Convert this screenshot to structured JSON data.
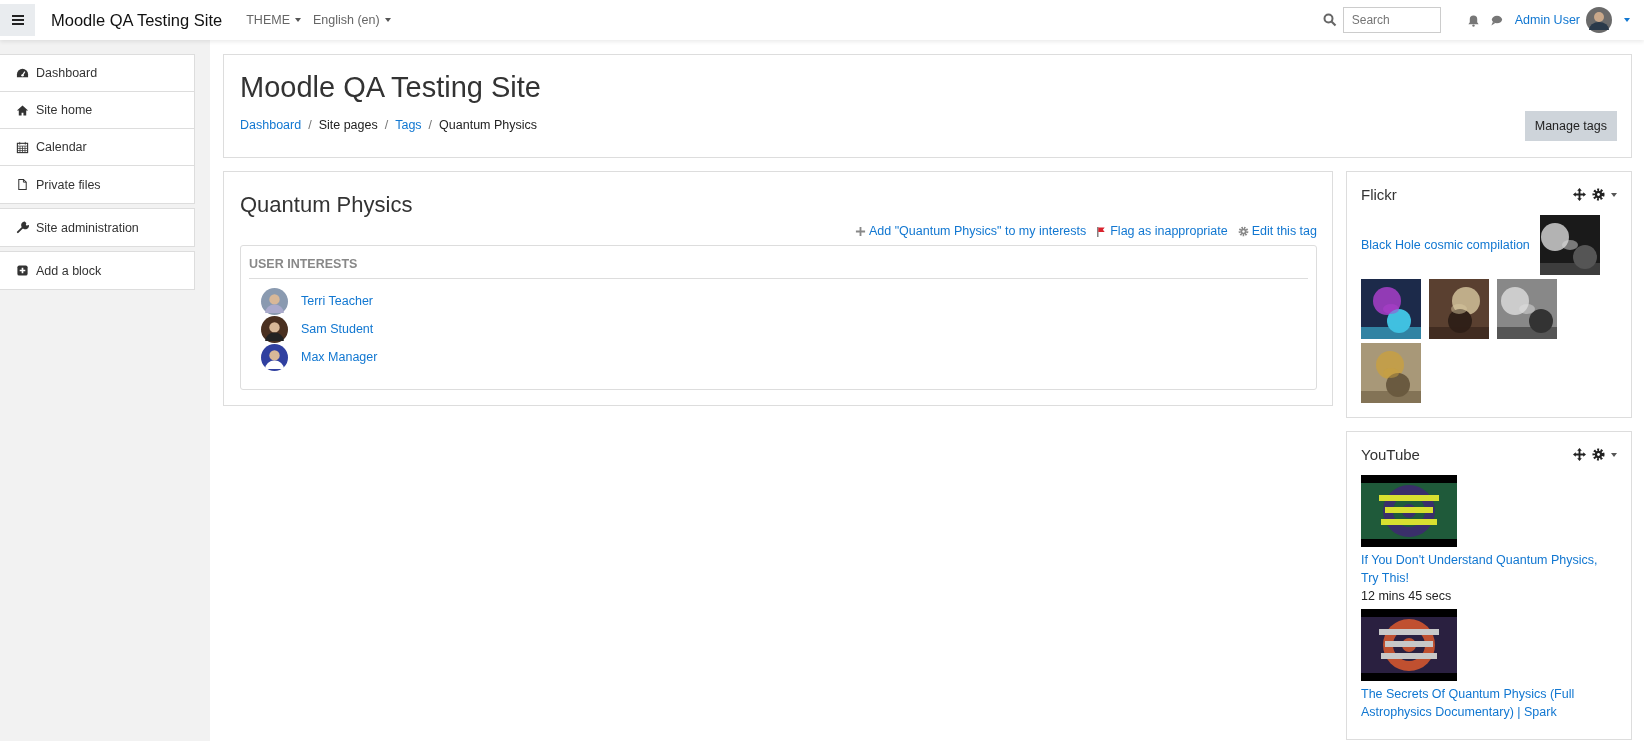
{
  "navbar": {
    "site_name": "Moodle QA Testing Site",
    "menus": [
      "THEME",
      "English (en)"
    ],
    "search": {
      "placeholder": "Search"
    },
    "user": "Admin User"
  },
  "sidebar": {
    "groups": [
      [
        {
          "label": "Dashboard"
        },
        {
          "label": "Site home"
        },
        {
          "label": "Calendar"
        },
        {
          "label": "Private files"
        }
      ],
      [
        {
          "label": "Site administration"
        }
      ],
      [
        {
          "label": "Add a block"
        }
      ]
    ]
  },
  "header": {
    "title": "Moodle QA Testing Site",
    "separator": "/",
    "breadcrumb": [
      {
        "label": "Dashboard",
        "link": true
      },
      {
        "label": "Site pages",
        "link": false
      },
      {
        "label": "Tags",
        "link": true
      },
      {
        "label": "Quantum Physics",
        "link": false
      }
    ],
    "button": "Manage tags"
  },
  "tag": {
    "title": "Quantum Physics",
    "actions": [
      {
        "label": "Add \"Quantum Physics\" to my interests"
      },
      {
        "label": "Flag as inappropriate"
      },
      {
        "label": "Edit this tag"
      }
    ],
    "section": "USER INTERESTS",
    "users": [
      "Terri Teacher",
      "Sam Student",
      "Max Manager"
    ]
  },
  "blocks": [
    {
      "kind": "flickr",
      "title": "Flickr",
      "link": "Black Hole cosmic compilation"
    },
    {
      "kind": "youtube",
      "title": "YouTube",
      "videos": [
        {
          "title": "If You Don't Understand Quantum Physics, Try This!",
          "duration": "12 mins 45 secs"
        },
        {
          "title": "The Secrets Of Quantum Physics (Full Astrophysics Documentary) | Spark"
        }
      ]
    }
  ]
}
